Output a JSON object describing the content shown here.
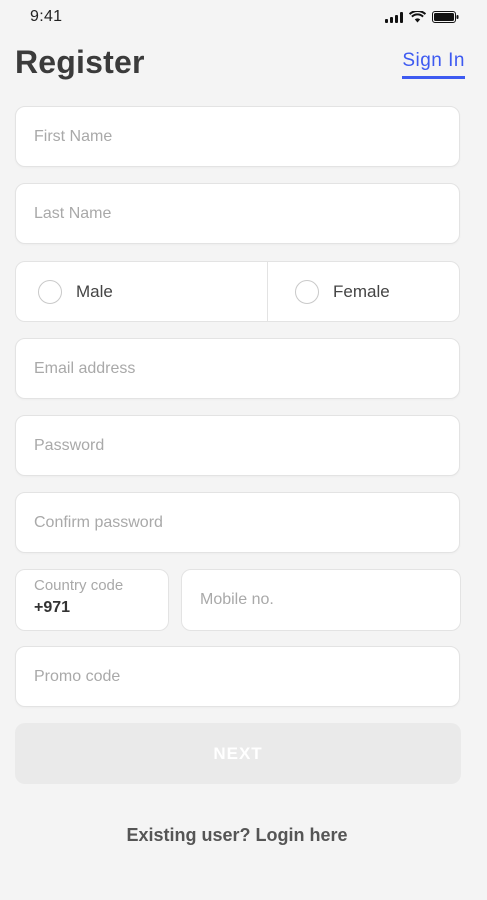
{
  "status_bar": {
    "time": "9:41",
    "icons": [
      "signal-icon",
      "wifi-icon",
      "battery-icon"
    ]
  },
  "header": {
    "title": "Register",
    "signin_label": "Sign In",
    "accent_color": "#3d5af1"
  },
  "form": {
    "first_name": {
      "placeholder": "First Name",
      "value": ""
    },
    "last_name": {
      "placeholder": "Last Name",
      "value": ""
    },
    "gender": {
      "options": [
        {
          "label": "Male",
          "selected": false
        },
        {
          "label": "Female",
          "selected": false
        }
      ]
    },
    "email": {
      "placeholder": "Email address",
      "value": ""
    },
    "password": {
      "placeholder": "Password",
      "value": ""
    },
    "confirm_password": {
      "placeholder": "Confirm password",
      "value": ""
    },
    "country_code": {
      "caption": "Country code",
      "value": "+971"
    },
    "mobile": {
      "placeholder": "Mobile no.",
      "value": ""
    },
    "promo_code": {
      "placeholder": "Promo code",
      "value": ""
    },
    "next_label": "NEXT"
  },
  "footer": {
    "login_text": "Existing user? Login here"
  }
}
